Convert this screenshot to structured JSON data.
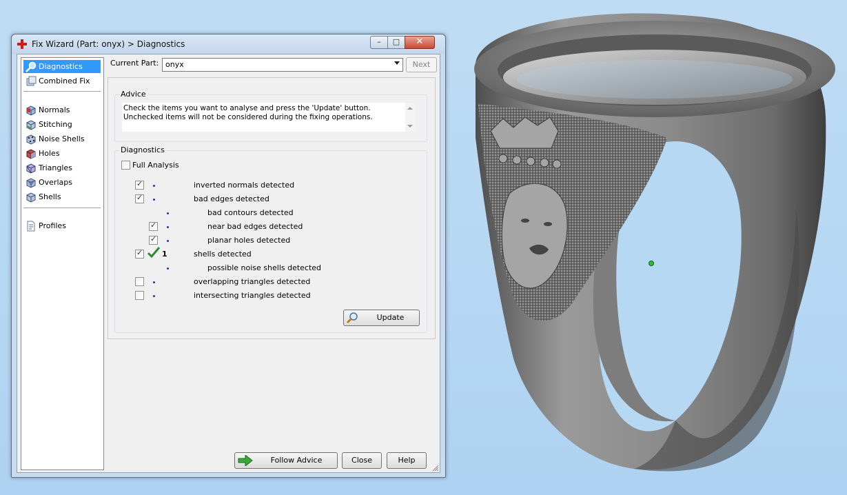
{
  "window": {
    "title": "Fix Wizard (Part: onyx) > Diagnostics",
    "caption_buttons": {
      "minimize": "–",
      "maximize": "□",
      "close": "✕"
    }
  },
  "sidebar": {
    "items": [
      {
        "label": "Diagnostics",
        "icon": "magnifier-icon",
        "selected": true
      },
      {
        "label": "Combined Fix",
        "icon": "combined-fix-icon"
      },
      {
        "label": "Normals",
        "icon": "normals-cube-icon"
      },
      {
        "label": "Stitching",
        "icon": "stitching-cube-icon"
      },
      {
        "label": "Noise Shells",
        "icon": "noise-shells-cube-icon"
      },
      {
        "label": "Holes",
        "icon": "holes-cube-icon"
      },
      {
        "label": "Triangles",
        "icon": "triangles-cube-icon"
      },
      {
        "label": "Overlaps",
        "icon": "overlaps-cube-icon"
      },
      {
        "label": "Shells",
        "icon": "shells-cube-icon"
      },
      {
        "label": "Profiles",
        "icon": "profiles-document-icon"
      }
    ]
  },
  "current_part": {
    "label": "Current Part:",
    "value": "onyx"
  },
  "next_button": "Next",
  "advice": {
    "title": "Advice",
    "text": "Check the items you want to analyse and press the 'Update' button. Unchecked items will not be considered during the fixing operations."
  },
  "diagnostics": {
    "title": "Diagnostics",
    "full_analysis": {
      "label": "Full Analysis",
      "checked": false
    },
    "rows": [
      {
        "label": "inverted normals detected",
        "checked": true,
        "indent": 0
      },
      {
        "label": "bad edges detected",
        "checked": true,
        "indent": 0
      },
      {
        "label": "bad contours detected",
        "checked": null,
        "indent": 1
      },
      {
        "label": "near bad edges detected",
        "checked": true,
        "indent": 1
      },
      {
        "label": "planar holes detected",
        "checked": true,
        "indent": 1
      },
      {
        "label": "shells detected",
        "checked": true,
        "indent": 0,
        "status": "ok",
        "count": "1"
      },
      {
        "label": "possible noise shells detected",
        "checked": null,
        "indent": 1
      },
      {
        "label": "overlapping triangles detected",
        "checked": false,
        "indent": 0
      },
      {
        "label": "intersecting triangles detected",
        "checked": false,
        "indent": 0
      }
    ]
  },
  "buttons": {
    "update": "Update",
    "follow_advice": "Follow Advice",
    "close": "Close",
    "help": "Help"
  },
  "colors": {
    "viewport_bg": "#b7d8f3",
    "selection": "#3399ff",
    "ring": "#8a8a8a",
    "check_ok": "#2e8b2e",
    "arrow": "#3aa83a"
  }
}
